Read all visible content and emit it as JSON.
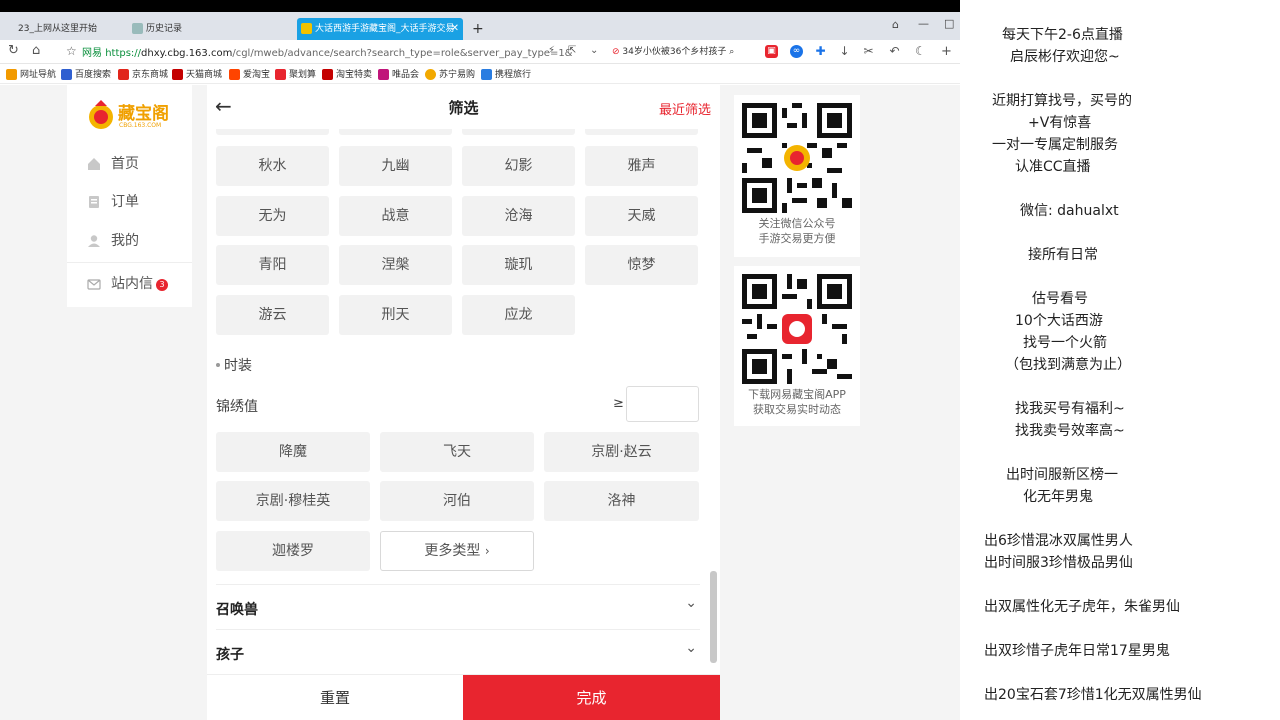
{
  "browser": {
    "tabs": [
      {
        "label": "23_上网从这里开始"
      },
      {
        "label": "历史记录"
      },
      {
        "label": "大话西游手游藏宝阁_大话手游交易"
      }
    ],
    "url_prefix": "网易",
    "url_scheme": "https://",
    "url_host": "dhxy.cbg.163.com",
    "url_path": "/cgl/mweb/advance/search?search_type=role&server_pay_type=1&",
    "news_text": "34岁小伙被36个乡村孩子",
    "bookmarks": [
      "网址导航",
      "百度搜索",
      "京东商城",
      "天猫商城",
      "爱淘宝",
      "聚划算",
      "淘宝特卖",
      "唯品会",
      "苏宁易购",
      "携程旅行"
    ]
  },
  "sidebar": {
    "logo_text": "藏宝阁",
    "logo_sub": "CBG.163.COM",
    "items": [
      {
        "label": "首页"
      },
      {
        "label": "订单"
      },
      {
        "label": "我的"
      },
      {
        "label": "站内信",
        "badge": "3"
      }
    ]
  },
  "panel": {
    "title": "筛选",
    "recent_label": "最近筛选",
    "school_options": [
      "秋水",
      "九幽",
      "幻影",
      "雅声",
      "无为",
      "战意",
      "沧海",
      "天威",
      "青阳",
      "涅槃",
      "璇玑",
      "惊梦",
      "游云",
      "刑天",
      "应龙"
    ],
    "fashion_label": "时装",
    "jinxiu_label": "锦绣值",
    "gte_symbol": "≥",
    "fashion_options": [
      "降魔",
      "飞天",
      "京剧·赵云",
      "京剧·穆桂英",
      "河伯",
      "洛神",
      "迦楼罗"
    ],
    "more_types": "更多类型",
    "accordions": [
      "召唤兽",
      "孩子"
    ],
    "reset_label": "重置",
    "done_label": "完成"
  },
  "qr": [
    {
      "caption_line1": "关注微信公众号",
      "caption_line2": "手游交易更方便"
    },
    {
      "caption_line1": "下载网易藏宝阁APP",
      "caption_line2": "获取交易实时动态"
    }
  ],
  "overlay_lines": [
    "每天下午2-6点直播",
    "启辰彬仔欢迎您~",
    "近期打算找号，买号的",
    "+V有惊喜",
    "一对一专属定制服务",
    "认准CC直播",
    "微信:    dahualxt",
    "接所有日常",
    "估号看号",
    "10个大话西游",
    "找号一个火箭",
    "（包找到满意为止）",
    "找我买号有福利~",
    "找我卖号效率高~",
    "出时间服新区榜一",
    "化无年男鬼",
    "出6珍惜混冰双属性男人",
    "出时间服3珍惜极品男仙",
    "出双属性化无子虎年，朱雀男仙",
    "出双珍惜子虎年日常17星男鬼",
    "出20宝石套7珍惜1化无双属性男仙"
  ]
}
